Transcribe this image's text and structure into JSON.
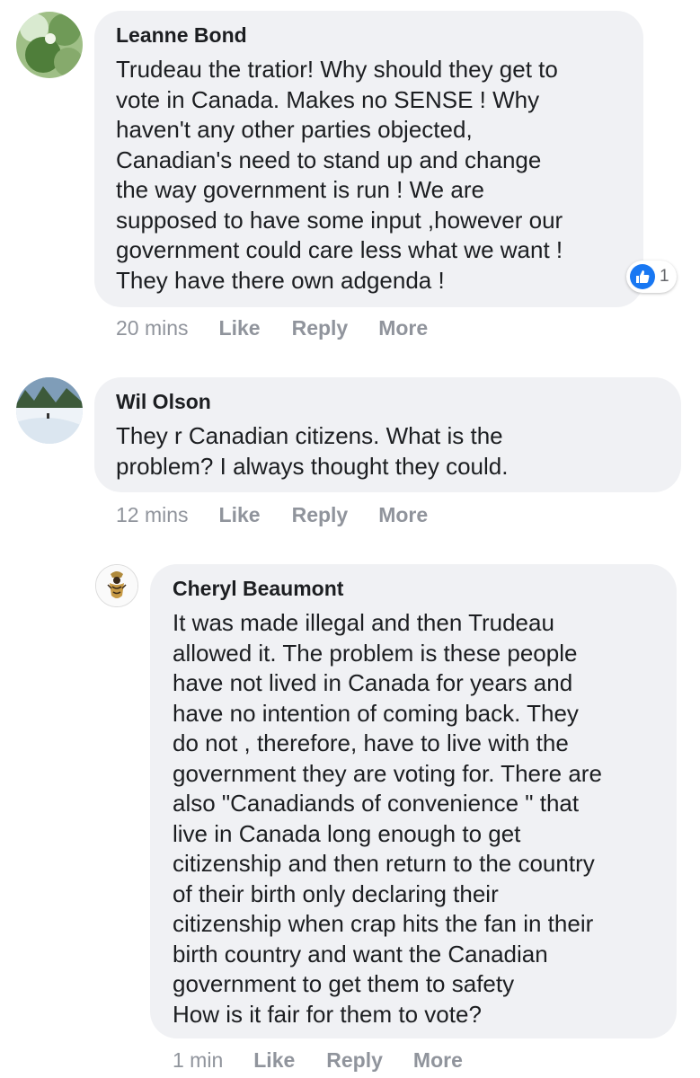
{
  "comments": [
    {
      "author": "Leanne Bond",
      "text": "Trudeau the tratior! Why should they get to\nvote in Canada. Makes no SENSE ! Why\nhaven't any other parties objected,\nCanadian's need to stand up and change\nthe way government is run ! We are\nsupposed to have some input ,however our\ngovernment could care less what we want !\nThey have there own adgenda !",
      "time": "20 mins",
      "like": "Like",
      "reply": "Reply",
      "more": "More",
      "reactions": {
        "icon": "like-icon",
        "count": "1"
      }
    },
    {
      "author": "Wil Olson",
      "text": "They r Canadian citizens. What is the\nproblem? I always thought they could.",
      "time": "12 mins",
      "like": "Like",
      "reply": "Reply",
      "more": "More"
    },
    {
      "author": "Cheryl Beaumont",
      "text": "It was made illegal and then Trudeau\nallowed it. The problem is these people\nhave not lived in Canada for years and\nhave no intention of coming back. They\ndo not , therefore, have to live with the\ngovernment they are voting for. There are\nalso \"Canadiands of convenience \" that\nlive in Canada long enough to get\ncitizenship and then return to the country\nof their birth only declaring their\ncitizenship when crap hits the fan in their\nbirth country and want the Canadian\ngovernment to get them to safety\nHow is it fair for them to vote?",
      "time": "1 min",
      "like": "Like",
      "reply": "Reply",
      "more": "More"
    }
  ],
  "colors": {
    "bubble": "#f0f1f4",
    "meta": "#90949c",
    "text": "#1c1e21",
    "like_blue": "#1877f2"
  }
}
